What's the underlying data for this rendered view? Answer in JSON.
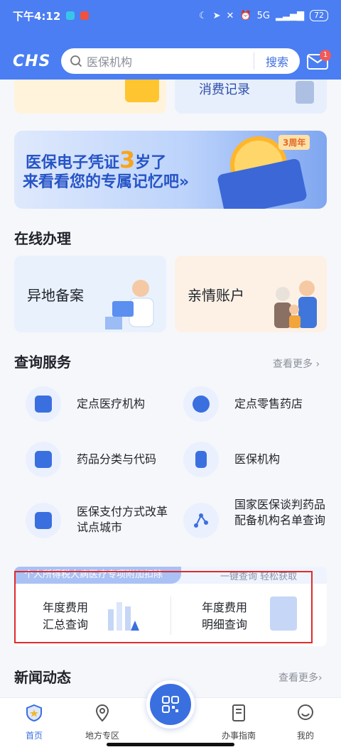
{
  "status_bar": {
    "time": "下午4:12",
    "signal": "5G",
    "battery": "72"
  },
  "header": {
    "logo": "CHS",
    "search_placeholder": "医保机构",
    "search_button": "搜索",
    "mail_badge": "1"
  },
  "top_cards": {
    "consumption_records": "消费记录"
  },
  "banner": {
    "line1_before": "医保电子凭证",
    "line1_num": "3",
    "line1_after": "岁了",
    "line2": "来看看您的专属记忆吧»",
    "ribbon": "3周年"
  },
  "online": {
    "title": "在线办理",
    "items": [
      {
        "label": "异地备案"
      },
      {
        "label": "亲情账户"
      }
    ]
  },
  "query": {
    "title": "查询服务",
    "more": "查看更多 ›",
    "items": [
      {
        "label": "定点医疗机构",
        "icon": "hospital-plus-icon"
      },
      {
        "label": "定点零售药店",
        "icon": "pill-icon"
      },
      {
        "label": "药品分类与代码",
        "icon": "document-icon"
      },
      {
        "label": "医保机构",
        "icon": "org-chart-icon"
      },
      {
        "label": "医保支付方式改革试点城市",
        "icon": "payment-screen-icon"
      },
      {
        "label": "国家医保谈判药品配备机构名单查询",
        "icon": "network-icon"
      }
    ]
  },
  "tax": {
    "tag": "个人所得税大病医疗专项附加扣除",
    "slogan": "一键查询 轻松获取",
    "left_label": "年度费用\n汇总查询",
    "right_label": "年度费用\n明细查询"
  },
  "news": {
    "title": "新闻动态",
    "more": "查看更多›"
  },
  "tabbar": {
    "items": [
      {
        "label": "首页",
        "icon": "home-shield-icon",
        "active": true
      },
      {
        "label": "地方专区",
        "icon": "location-pin-icon",
        "active": false
      },
      {
        "label": "",
        "icon": "scan-qr-icon",
        "active": false
      },
      {
        "label": "办事指南",
        "icon": "guide-doc-icon",
        "active": false
      },
      {
        "label": "我的",
        "icon": "profile-face-icon",
        "active": false
      }
    ]
  },
  "colors": {
    "primary": "#3a6fe0",
    "header_bg": "#4a7ef2",
    "highlight": "#e02b2b"
  }
}
